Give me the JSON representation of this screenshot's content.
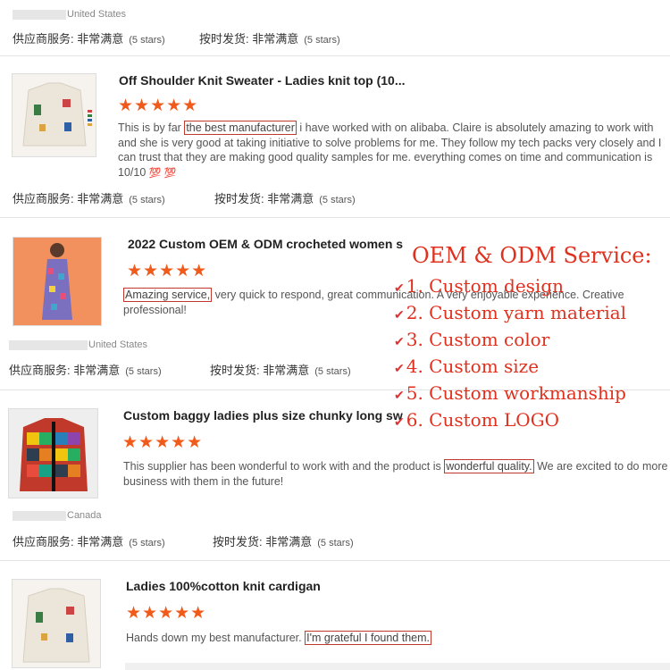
{
  "reviews": [
    {
      "country": "United States",
      "ratings": {
        "service_label": "供应商服务:",
        "service_value": "非常满意",
        "service_stars": "(5 stars)",
        "delivery_label": "按时发货:",
        "delivery_value": "非常满意",
        "delivery_stars": "(5 stars)"
      }
    },
    {
      "title": "Off Shoulder Knit Sweater - Ladies knit top (10...",
      "stars": "★★★★★",
      "text_pre": "This is by far ",
      "highlight": "the best manufacturer",
      "text_post": " i have worked with on alibaba. Claire is absolutely amazing to work with and she is very good at taking initiative to solve problems for me. They follow my tech packs very closely and I can trust that they are making good quality samples for me. everything comes on time and communication is 10/10 ",
      "emoji": "💯 💯",
      "ratings": {
        "service_label": "供应商服务:",
        "service_value": "非常满意",
        "service_stars": "(5 stars)",
        "delivery_label": "按时发货:",
        "delivery_value": "非常满意",
        "delivery_stars": "(5 stars)"
      }
    },
    {
      "title": "2022 Custom OEM & ODM crocheted women s",
      "stars": "★★★★★",
      "highlight": "Amazing service,",
      "text_post": " very quick to respond, great communication. A very enjoyable experience. Creative professional!",
      "country": "United States",
      "ratings": {
        "service_label": "供应商服务:",
        "service_value": "非常满意",
        "service_stars": "(5 stars)",
        "delivery_label": "按时发货:",
        "delivery_value": "非常满意",
        "delivery_stars": "(5 stars)"
      }
    },
    {
      "title": "Custom baggy ladies plus size chunky long sw",
      "stars": "★★★★★",
      "text_pre": "This supplier has been wonderful to work with and the product is ",
      "highlight": "wonderful quality.",
      "text_post": " We are excited to do more business with them in the future!",
      "country": "Canada",
      "ratings": {
        "service_label": "供应商服务:",
        "service_value": "非常满意",
        "service_stars": "(5 stars)",
        "delivery_label": "按时发货:",
        "delivery_value": "非常满意",
        "delivery_stars": "(5 stars)"
      }
    },
    {
      "title": "Ladies 100%cotton knit cardigan",
      "stars": "★★★★★",
      "text_pre": "Hands down my best manufacturer. ",
      "highlight": "I'm grateful I found them."
    }
  ],
  "service_overlay": {
    "title": "OEM & ODM Service:",
    "items": [
      "1. Custom design",
      "2. Custom yarn material",
      "3. Custom color",
      "4. Custom size",
      "5. Custom workmanship",
      "6. Custom LOGO"
    ],
    "check_icon": "check-icon",
    "color": "#e0301e"
  },
  "colors": {
    "star": "#f05a1a",
    "highlight_border": "#c0392b"
  }
}
